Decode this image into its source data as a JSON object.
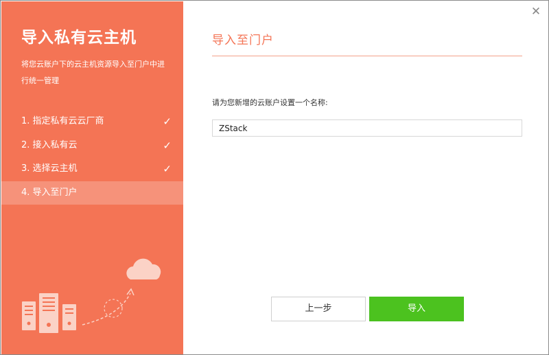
{
  "colors": {
    "sidebar_bg": "#f47455",
    "accent": "#f47455",
    "primary_button": "#4cc21f"
  },
  "sidebar": {
    "title": "导入私有云主机",
    "description": "将您云账户下的云主机资源导入至门户中进行统一管理",
    "steps": [
      {
        "label": "1. 指定私有云云厂商",
        "completed": true,
        "active": false
      },
      {
        "label": "2. 接入私有云",
        "completed": true,
        "active": false
      },
      {
        "label": "3. 选择云主机",
        "completed": true,
        "active": false
      },
      {
        "label": "4. 导入至门户",
        "completed": false,
        "active": true
      }
    ],
    "check_icon": "check-icon",
    "illustration_icons": [
      "cloud-icon",
      "server-icon"
    ]
  },
  "main": {
    "section_title": "导入至门户",
    "field_label": "请为您新增的云账户设置一个名称:",
    "name_input": {
      "value": "ZStack",
      "placeholder": ""
    }
  },
  "buttons": {
    "prev_label": "上一步",
    "import_label": "导入"
  },
  "close_icon": "close-icon"
}
